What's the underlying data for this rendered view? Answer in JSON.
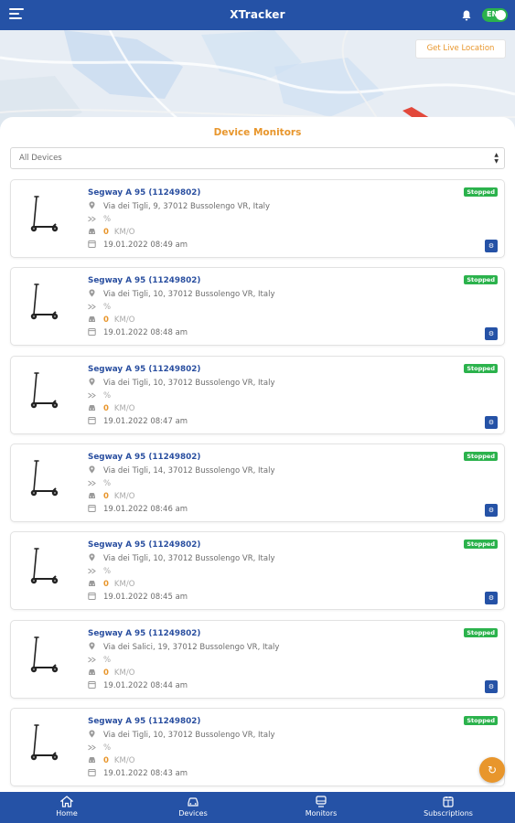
{
  "header": {
    "title": "XTracker",
    "lang_label": "EN"
  },
  "map": {
    "live_button": "Get Live Location"
  },
  "panel": {
    "title": "Device Monitors",
    "filter_value": "All Devices"
  },
  "devices": [
    {
      "name": "Segway A 95 (11249802)",
      "address": "Via dei Tigli, 9, 37012 Bussolengo VR, Italy",
      "battery": "%",
      "speed": "0",
      "speed_unit": "KM/O",
      "timestamp": "19.01.2022 08:49 am",
      "status": "Stopped"
    },
    {
      "name": "Segway A 95 (11249802)",
      "address": "Via dei Tigli, 10, 37012 Bussolengo VR, Italy",
      "battery": "%",
      "speed": "0",
      "speed_unit": "KM/O",
      "timestamp": "19.01.2022 08:48 am",
      "status": "Stopped"
    },
    {
      "name": "Segway A 95 (11249802)",
      "address": "Via dei Tigli, 10, 37012 Bussolengo VR, Italy",
      "battery": "%",
      "speed": "0",
      "speed_unit": "KM/O",
      "timestamp": "19.01.2022 08:47 am",
      "status": "Stopped"
    },
    {
      "name": "Segway A 95 (11249802)",
      "address": "Via dei Tigli, 14, 37012 Bussolengo VR, Italy",
      "battery": "%",
      "speed": "0",
      "speed_unit": "KM/O",
      "timestamp": "19.01.2022 08:46 am",
      "status": "Stopped"
    },
    {
      "name": "Segway A 95 (11249802)",
      "address": "Via dei Tigli, 10, 37012 Bussolengo VR, Italy",
      "battery": "%",
      "speed": "0",
      "speed_unit": "KM/O",
      "timestamp": "19.01.2022 08:45 am",
      "status": "Stopped"
    },
    {
      "name": "Segway A 95 (11249802)",
      "address": "Via dei Salici, 19, 37012 Bussolengo VR, Italy",
      "battery": "%",
      "speed": "0",
      "speed_unit": "KM/O",
      "timestamp": "19.01.2022 08:44 am",
      "status": "Stopped"
    },
    {
      "name": "Segway A 95 (11249802)",
      "address": "Via dei Tigli, 10, 37012 Bussolengo VR, Italy",
      "battery": "%",
      "speed": "0",
      "speed_unit": "KM/O",
      "timestamp": "19.01.2022 08:43 am",
      "status": "Stopped"
    }
  ],
  "nav": [
    {
      "label": "Home",
      "icon": "home-icon"
    },
    {
      "label": "Devices",
      "icon": "car-icon"
    },
    {
      "label": "Monitors",
      "icon": "monitor-icon"
    },
    {
      "label": "Subscriptions",
      "icon": "calendar-icon"
    }
  ],
  "colors": {
    "primary": "#2552a6",
    "accent": "#e8962c",
    "status_green": "#2bb24c"
  }
}
